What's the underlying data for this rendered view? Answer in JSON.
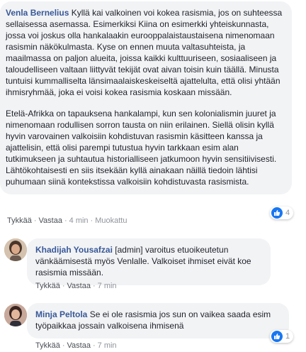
{
  "comments": [
    {
      "author": "Venla Bernelius",
      "paragraphs": [
        "Kyllä kai valkoinen voi kokea rasismia, jos on suhteessa sellaisessa asemassa. Esimerkiksi Kiina on esimerkki yhteiskunnasta, jossa voi joskus olla hankalaakin eurooppalaistaustaisena nimenomaan rasismin näkökulmasta. Kyse on ennen muuta valtasuhteista, ja maailmassa on paljon alueita, joissa kaikki kulttuuriseen, sosiaaliseen ja taloudelliseen valtaan liittyvät tekijät ovat aivan toisin kuin täällä. Minusta tuntuisi kummalliselta länsimaalaiskeskeiseltä ajattelulta, että olisi yhtään ihmisryhmää, joka ei voisi kokea rasismia koskaan missään.",
        "Etelä-Afrikka on tapauksena hankalampi, kun sen kolonialismin juuret ja nimenomaan rodullisen sorron tausta on niin erilainen. Siellä olisin kyllä hyvin varovainen valkoisiin kohdistuvan rasismin käsitteen kanssa ja ajattelisin, että olisi parempi tutustua hyvin tarkkaan esim alan tutkimukseen ja suhtautua historialliseen jatkumoon hyvin sensitiivisesti. Lähtökohtaisesti en siis itsekään kyllä ainakaan näillä tiedoin lähtisi puhumaan siinä kontekstissa valkoisiin kohdistuvasta rasismista."
      ],
      "like": "Tykkää",
      "reply": "Vastaa",
      "time": "4 min",
      "edited": "Muokattu",
      "reaction_count": "4"
    },
    {
      "author": "Khadijah Yousafzai",
      "text": "[admin] varoitus etuoikeutetun vänkäämisestä myös Venlalle. Valkoiset ihmiset eivät koe rasismia missään.",
      "like": "Tykkää",
      "reply": "Vastaa",
      "time": "7 min"
    },
    {
      "author": "Minja Peltola",
      "text": "Se ei ole rasismia jos sun on vaikea saada esim työpaikkaa jossain valkoisena ihmisenä",
      "like": "Tykkää",
      "reply": "Vastaa",
      "time": "7 min",
      "reaction_count": "1"
    }
  ],
  "colors": {
    "bubble": "#f2f3f5",
    "author": "#385898",
    "like_blue": "#1877f2",
    "meta": "#90949c"
  },
  "icons": [
    "like-icon"
  ]
}
